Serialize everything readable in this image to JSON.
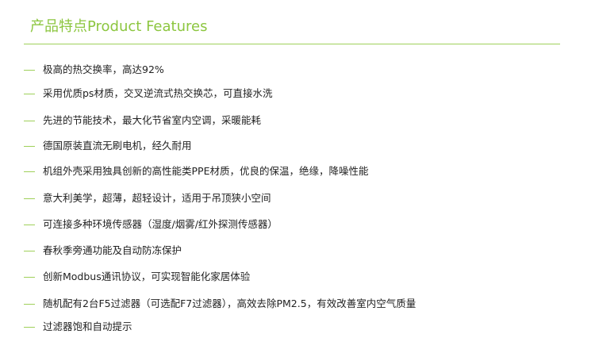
{
  "header": {
    "title": "产品特点Product Features"
  },
  "features": [
    "极高的热交换率，高达92%",
    "采用优质ps材质，交叉逆流式热交换芯，可直接水洗",
    "先进的节能技术，最大化节省室内空调，采暖能耗",
    "德国原装直流无刷电机，经久耐用",
    "机组外壳采用独具创新的高性能类PPE材质，优良的保温，绝缘，降噪性能",
    "意大利美学，超薄，超轻设计，适用于吊顶狭小空间",
    "可连接多种环境传感器（湿度/烟雾/红外探测传感器）",
    "春秋季旁通功能及自动防冻保护",
    "创新Modbus通讯协议，可实现智能化家居体验",
    "随机配有2台F5过滤器（可选配F7过滤器），高效去除PM2.5，有效改善室内空气质量",
    "过滤器饱和自动提示"
  ],
  "colors": {
    "accent": "#8cc63f",
    "rule": "#9fd05a",
    "text": "#222222"
  }
}
